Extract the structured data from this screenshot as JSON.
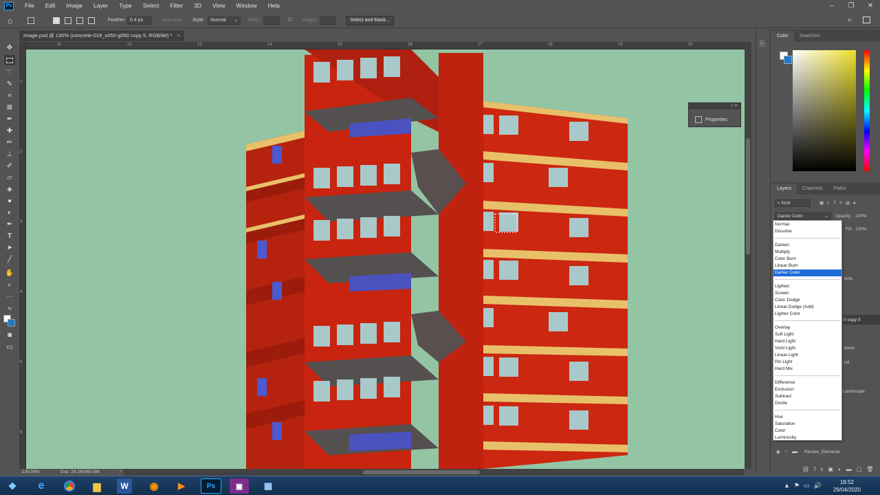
{
  "app": {
    "logo_text": "Ps"
  },
  "menu": [
    "File",
    "Edit",
    "Image",
    "Layer",
    "Type",
    "Select",
    "Filter",
    "3D",
    "View",
    "Window",
    "Help"
  ],
  "window_controls": [
    "–",
    "❐",
    "✕"
  ],
  "options_bar": {
    "feather_label": "Feather:",
    "feather_value": "0.4 px",
    "antialias_label": "Anti-alias",
    "style_label": "Style:",
    "style_value": "Normal",
    "width_label": "Width:",
    "height_label": "Height:",
    "select_mask_button": "Select and Mask..."
  },
  "document": {
    "tab_title": "Image.psd @ 130% (concrete-019_s050-g050 copy 5, RGB/8#) *",
    "close_glyph": "×",
    "zoom": "130.09%",
    "doc_info": "Doc: 29.1M/360.5M",
    "arrow": "›"
  },
  "rulers": {
    "top": [
      "11",
      "12",
      "13",
      "14",
      "15",
      "16",
      "17",
      "18",
      "19",
      "20"
    ],
    "left": [
      "1",
      "2",
      "3",
      "4",
      "5",
      "6",
      "7"
    ]
  },
  "properties_panel": {
    "title": "Properties",
    "bar_glyphs": "» ✕"
  },
  "color_panel": {
    "tabs": [
      "Color",
      "Swatches"
    ]
  },
  "layers_panel": {
    "tabs": [
      "Layers",
      "Channels",
      "Paths"
    ],
    "kind_filter": "Kind",
    "blend_mode": "Darker Color",
    "opacity_label": "Opacity:",
    "opacity_value": "100%",
    "fill_label": "Fill:",
    "fill_value": "100%",
    "partial_labels": [
      "ents",
      "0 copy 5",
      "dows",
      "nd",
      "Landscape"
    ],
    "group_name": "Render_Elements"
  },
  "blend_modes": {
    "groups": [
      [
        "Normal",
        "Dissolve"
      ],
      [
        "Darken",
        "Multiply",
        "Color Burn",
        "Linear Burn",
        "Darker Color"
      ],
      [
        "Lighten",
        "Screen",
        "Color Dodge",
        "Linear Dodge (Add)",
        "Lighter Color"
      ],
      [
        "Overlay",
        "Soft Light",
        "Hard Light",
        "Vivid Light",
        "Linear Light",
        "Pin Light",
        "Hard Mix"
      ],
      [
        "Difference",
        "Exclusion",
        "Subtract",
        "Divide"
      ],
      [
        "Hue",
        "Saturation",
        "Color",
        "Luminosity"
      ]
    ],
    "selected": "Darker Color"
  },
  "taskbar": {
    "time": "18:52",
    "date": "29/04/2020",
    "apps": [
      "start",
      "internet-explorer",
      "chrome",
      "file-explorer",
      "word",
      "firefox",
      "media-player",
      "photoshop",
      "app-purple",
      "app-window"
    ]
  }
}
